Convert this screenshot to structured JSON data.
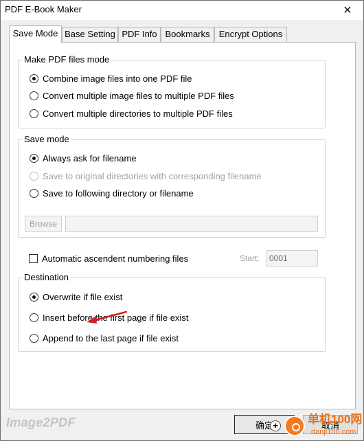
{
  "window": {
    "title": "PDF E-Book Maker",
    "close_glyph": "✕"
  },
  "tabs": [
    {
      "label": "Save Mode",
      "active": true
    },
    {
      "label": "Base Setting",
      "active": false
    },
    {
      "label": "PDF Info",
      "active": false
    },
    {
      "label": "Bookmarks",
      "active": false
    },
    {
      "label": "Encrypt Options",
      "active": false
    }
  ],
  "make_pdf_mode": {
    "title": "Make PDF files mode",
    "options": [
      {
        "label": "Combine image files into one PDF file",
        "selected": true
      },
      {
        "label": "Convert multiple image files to multiple PDF files",
        "selected": false
      },
      {
        "label": "Convert multiple directories to multiple PDF files",
        "selected": false
      }
    ]
  },
  "save_mode": {
    "title": "Save mode",
    "options": [
      {
        "label": "Always ask for filename",
        "selected": true,
        "enabled": true
      },
      {
        "label": "Save to original directories with corresponding filename",
        "selected": false,
        "enabled": false
      },
      {
        "label": "Save to following directory or filename",
        "selected": false,
        "enabled": true
      }
    ],
    "browse_label": "Browse",
    "path_value": ""
  },
  "numbering": {
    "label": "Automatic ascendent numbering files",
    "checked": false,
    "start_label": "Start:",
    "start_value": "0001"
  },
  "destination": {
    "title": "Destination",
    "options": [
      {
        "label": "Overwrite if file exist",
        "selected": true
      },
      {
        "label": "Insert before the first page if file exist",
        "selected": false
      },
      {
        "label": "Append to the last page if file exist",
        "selected": false
      }
    ]
  },
  "footer": {
    "brand": "Image2PDF",
    "ok_label": "确定",
    "cancel_label": "取消"
  },
  "watermark": {
    "name": "单机100网",
    "url": "danji100.com",
    "color": "#f47a1f"
  },
  "annotation": {
    "arrow_color": "#d42020"
  }
}
